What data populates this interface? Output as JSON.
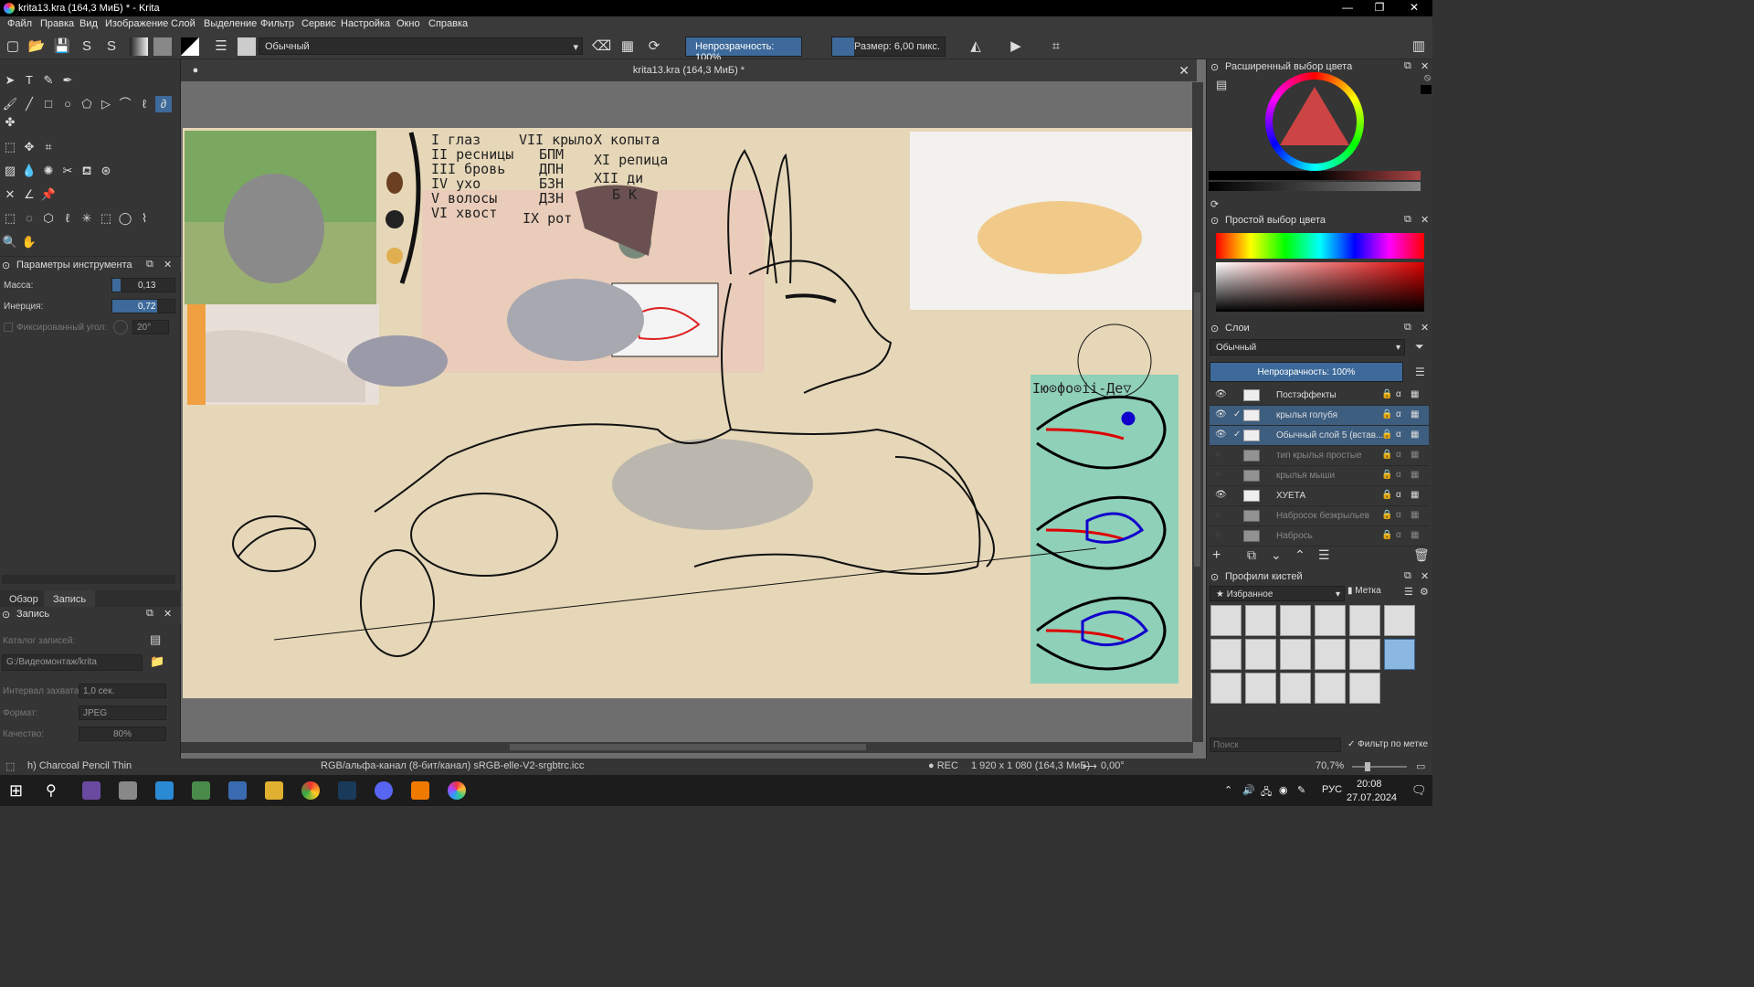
{
  "window": {
    "title": "krita13.kra (164,3 МиБ) * - Krita"
  },
  "menu": [
    "Файл",
    "Правка",
    "Вид",
    "Изображение",
    "Слой",
    "Выделение",
    "Фильтр",
    "Сервис",
    "Настройка",
    "Окно",
    "Справка"
  ],
  "toolbar": {
    "blend_mode": "Обычный",
    "opacity": "Непрозрачность: 100%",
    "size": "Размер: 6,00 пикс."
  },
  "document": {
    "tab_title": "krita13.kra (164,3 МиБ) *"
  },
  "tool_options": {
    "title": "Параметры инструмента",
    "mass_label": "Масса:",
    "mass_value": "0,13",
    "mass_fraction": 0.13,
    "inertia_label": "Инерция:",
    "inertia_value": "0,72",
    "inertia_fraction": 0.72,
    "fixed_angle_label": "Фиксированный угол:",
    "fixed_angle_value": "20°"
  },
  "bottom_tabs": [
    "Обзор",
    "Запись"
  ],
  "recorder": {
    "title": "Запись",
    "catalog_label": "Каталог записей:",
    "catalog_path": "G:/Видеомонтаж/krita",
    "interval_label": "Интервал захвата:",
    "interval_value": "1,0 сек.",
    "format_label": "Формат:",
    "format_value": "JPEG",
    "quality_label": "Качество:",
    "quality_value": "80%"
  },
  "color_panels": {
    "advanced": "Расширенный выбор цвета",
    "simple": "Простой выбор цвета"
  },
  "layers": {
    "title": "Слои",
    "blend_mode": "Обычный",
    "opacity": "Непрозрачность: 100%",
    "items": [
      {
        "name": "Постэффекты",
        "visible": true,
        "selected": false
      },
      {
        "name": "крылья голубя",
        "visible": true,
        "selected": true
      },
      {
        "name": "Обычный слой 5 (встав...",
        "visible": true,
        "selected": true
      },
      {
        "name": "тип крылья простые",
        "visible": false,
        "selected": false
      },
      {
        "name": "крылья мыши",
        "visible": false,
        "selected": false
      },
      {
        "name": "ХУЕТА",
        "visible": true,
        "selected": false
      },
      {
        "name": "Набросок безкрыльев",
        "visible": false,
        "selected": false
      },
      {
        "name": "Набрось",
        "visible": false,
        "selected": false
      }
    ]
  },
  "brush_presets": {
    "title": "Профили кистей",
    "tag": "Избранное",
    "tag_button": "Метка",
    "search_placeholder": "Поиск",
    "filter_label": "Фильтр по метке"
  },
  "canvas_notes": {
    "col1": [
      "I глаз",
      "II ресницы",
      "III бровь",
      "IV ухо",
      "V волосы",
      "VI хвост"
    ],
    "col2": [
      "VII крыло",
      "БПМ",
      "ДПН",
      "БЗН",
      "ДЗН",
      "IX рот"
    ],
    "col3": [
      "X копыта",
      "XI репица",
      "XII ди",
      "Б К"
    ],
    "ref_label": "Iю⊙фо⊙ii-Де▽"
  },
  "status": {
    "brush": "h) Charcoal Pencil Thin",
    "color_space": "RGB/альфа-канал (8-бит/канал)  sRGB-elle-V2-srgbtrc.icc",
    "rec": "● REC",
    "dimensions": "1 920 x 1 080 (164,3 МиБ)",
    "rotation": "0,00°",
    "zoom": "70,7%"
  },
  "taskbar": {
    "lang": "РУС",
    "time": "20:08",
    "date": "27.07.2024"
  }
}
